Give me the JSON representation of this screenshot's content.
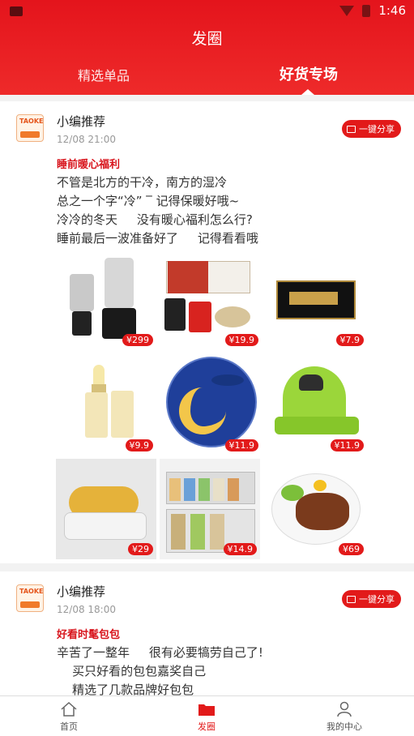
{
  "status": {
    "time": "1:46"
  },
  "header": {
    "title": "发圈",
    "tabs": [
      {
        "label": "精选单品"
      },
      {
        "label": "好货专场"
      }
    ]
  },
  "posts": [
    {
      "author": "小编推荐",
      "time": "12/08 21:00",
      "share_label": "一键分享",
      "subject": "睡前暖心福利",
      "body": "不管是北方的干冷，南方的湿冷\n总之一个字“冷” ‾ 记得保暖好哦~\n冷冷的冬天     没有暖心福利怎么行?\n睡前最后一波准备好了     记得看看哦",
      "products": [
        {
          "name": "blender",
          "price": "¥299"
        },
        {
          "name": "instant-food-box",
          "price": "¥19.9"
        },
        {
          "name": "ginseng-gift-box",
          "price": "¥7.9"
        },
        {
          "name": "lip-balm",
          "price": "¥9.9"
        },
        {
          "name": "moon-plate",
          "price": "¥11.9"
        },
        {
          "name": "window-cleaner",
          "price": "¥11.9"
        },
        {
          "name": "capsule-jar",
          "price": "¥29"
        },
        {
          "name": "storage-containers",
          "price": "¥14.9"
        },
        {
          "name": "steak-plate",
          "price": "¥69"
        }
      ]
    },
    {
      "author": "小编推荐",
      "time": "12/08 18:00",
      "share_label": "一键分享",
      "subject": "好看时髦包包",
      "body": "辛苦了一整年     很有必要犒劳自己了!\n    买只好看的包包嘉奖自己\n    精选了几款品牌好包包"
    }
  ],
  "nav": [
    {
      "label": "首页"
    },
    {
      "label": "发圈"
    },
    {
      "label": "我的中心"
    }
  ],
  "colors": {
    "brand_red": "#e21a1a"
  }
}
